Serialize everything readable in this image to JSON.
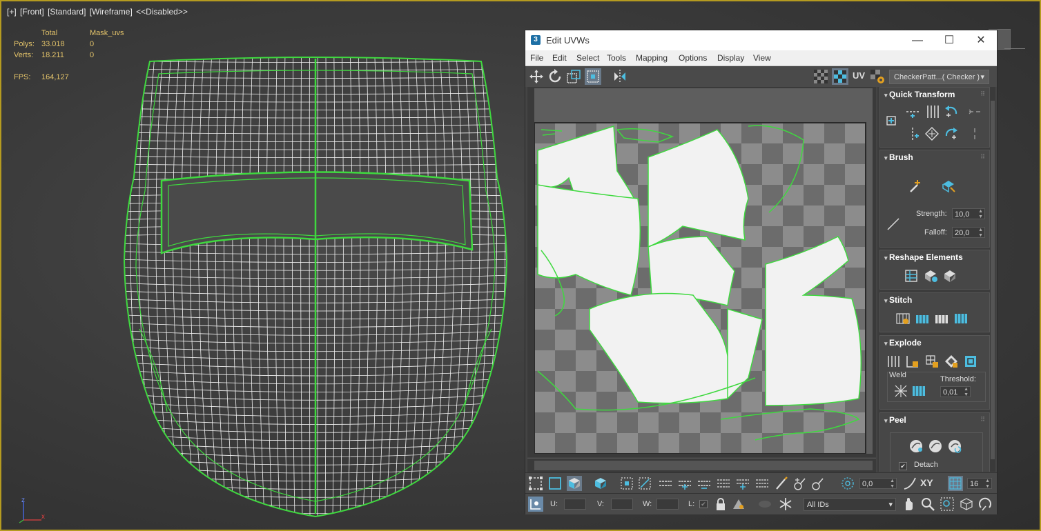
{
  "viewport": {
    "label_parts": [
      "[+]",
      "[Front]",
      "[Standard]",
      "[Wireframe]",
      "<<Disabled>>"
    ],
    "stats": {
      "col_total": "Total",
      "col_mask": "Mask_uvs",
      "polys_label": "Polys:",
      "polys_total": "33.018",
      "polys_mask": "0",
      "verts_label": "Verts:",
      "verts_total": "18.211",
      "verts_mask": "0",
      "fps_label": "FPS:",
      "fps_value": "164,127"
    },
    "axis": {
      "z": "z",
      "x": "x"
    },
    "colors": {
      "border": "#b59b20",
      "wire": "#ffffff",
      "seam": "#3fd93f",
      "stats": "#e3c36a"
    }
  },
  "uvw": {
    "app_icon": "3",
    "title": "Edit UVWs",
    "window_controls": {
      "minimize": "—",
      "maximize": "☐",
      "close": "✕"
    },
    "menu": [
      "File",
      "Edit",
      "Select",
      "Tools",
      "Mapping",
      "Options",
      "Display",
      "View"
    ],
    "toolbar_top": {
      "icons": [
        "move-icon",
        "rotate-icon",
        "scale-icon",
        "freeform-icon",
        "mirror-icon"
      ],
      "right_icons": [
        "checker-toggle-icon",
        "checker-map-icon"
      ],
      "uv_label": "UV",
      "settings_icon": "settings-icon",
      "texture_select": "CheckerPatt...( Checker )"
    },
    "panel": {
      "quick_transform": {
        "title": "Quick Transform"
      },
      "brush": {
        "title": "Brush",
        "strength_label": "Strength:",
        "strength_value": "10,0",
        "falloff_label": "Falloff:",
        "falloff_value": "20,0"
      },
      "reshape": {
        "title": "Reshape Elements"
      },
      "stitch": {
        "title": "Stitch"
      },
      "explode": {
        "title": "Explode",
        "weld_label": "Weld",
        "threshold_label": "Threshold:",
        "threshold_value": "0,01"
      },
      "peel": {
        "title": "Peel",
        "detach_label": "Detach",
        "detach_checked": true
      }
    },
    "bottom": {
      "angle_value": "0,0",
      "xy_label": "XY",
      "grid_value": "16",
      "u_label": "U:",
      "v_label": "V:",
      "w_label": "W:",
      "l_label": "L:",
      "ids_select": "All IDs"
    }
  }
}
